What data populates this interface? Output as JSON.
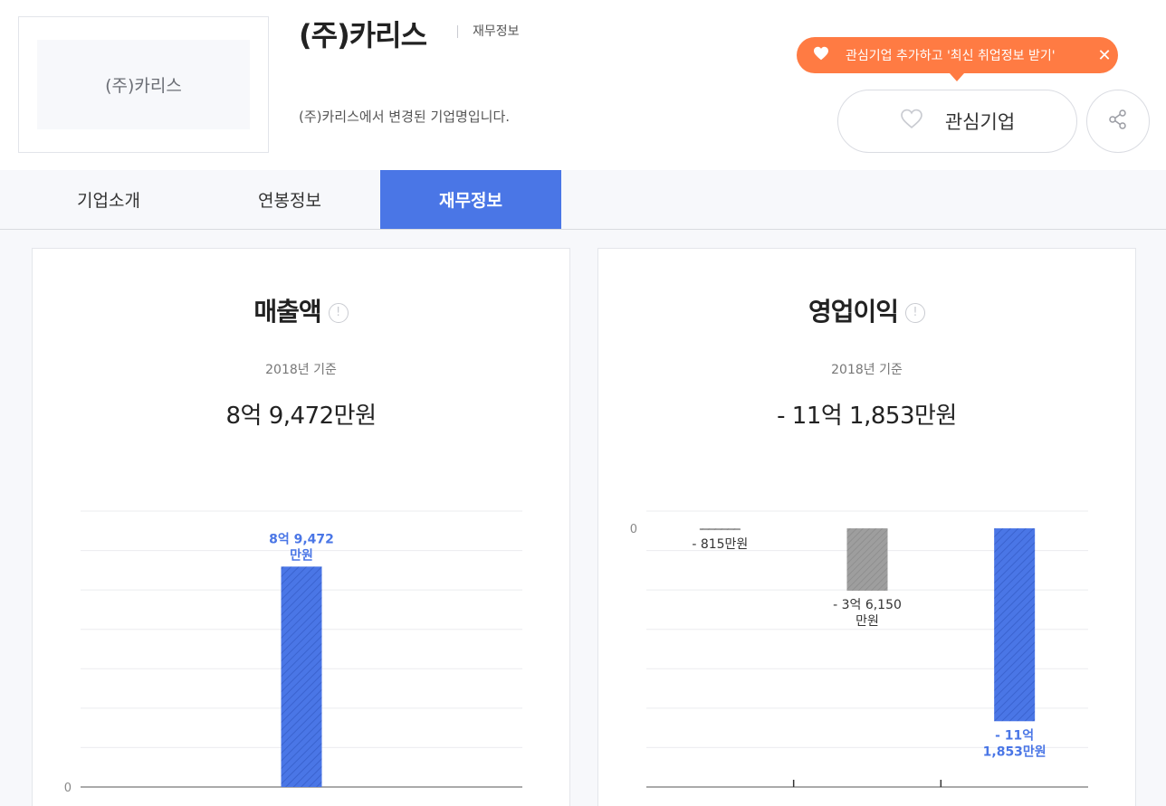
{
  "company": {
    "logo_text": "(주)카리스",
    "name": "(주)카리스",
    "breadcrumb": "재무정보",
    "changed_note": "(주)카리스에서 변경된 기업명입니다."
  },
  "tooltip": {
    "text": "관심기업 추가하고 '최신 취업정보 받기'",
    "close_symbol": "✕"
  },
  "buttons": {
    "favorite_label": "관심기업"
  },
  "tabs": [
    {
      "label": "기업소개",
      "active": false
    },
    {
      "label": "연봉정보",
      "active": false
    },
    {
      "label": "재무정보",
      "active": true
    }
  ],
  "colors": {
    "accent": "#4a76e6",
    "tooltip": "#ff7b43",
    "neutral_bar": "#9e9e9e"
  },
  "cards": {
    "revenue": {
      "title": "매출액",
      "basis": "2018년 기준",
      "value": "8억 9,472만원"
    },
    "operating_profit": {
      "title": "영업이익",
      "basis": "2018년 기준",
      "value": "- 11억 1,853만원"
    }
  },
  "chart_data": [
    {
      "type": "bar",
      "title": "매출액",
      "categories": [
        "",
        "",
        ""
      ],
      "values": [
        null,
        89472,
        null
      ],
      "value_labels": [
        "",
        "8억 9,472\n만원",
        ""
      ],
      "ylim": [
        0,
        112000
      ],
      "zero_label": "0",
      "grid": true,
      "highlight_index": 1
    },
    {
      "type": "bar",
      "title": "영업이익",
      "categories": [
        "",
        "",
        ""
      ],
      "values": [
        -815,
        -36150,
        -111853
      ],
      "value_labels": [
        "- 815만원",
        "- 3억 6,150\n만원",
        "- 11억\n1,853만원"
      ],
      "ylim": [
        -150000,
        10000
      ],
      "zero_label": "0",
      "grid": true,
      "highlight_index": 2
    }
  ]
}
